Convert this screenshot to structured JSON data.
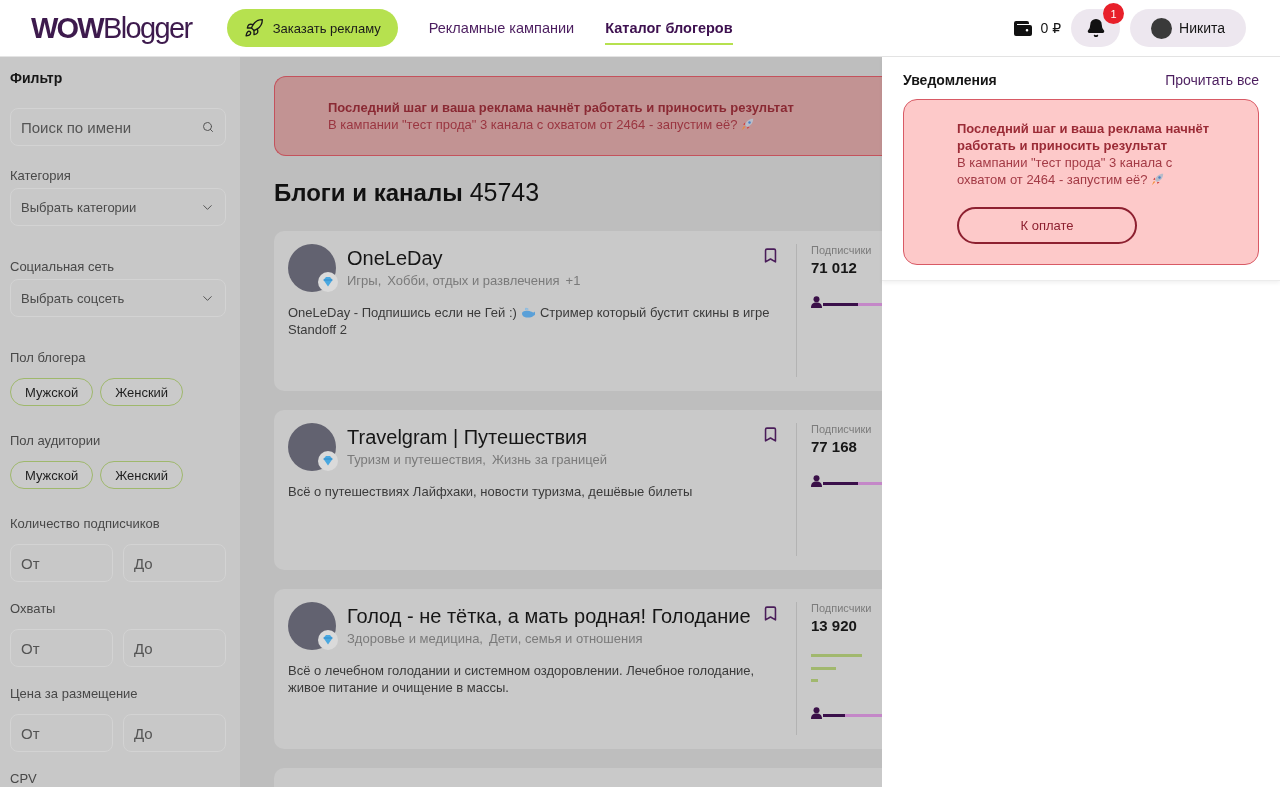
{
  "header": {
    "logo": "**WOW**Blogger",
    "order_button": "Заказать рекламу",
    "nav": [
      {
        "label": "Рекламные кампании",
        "selected": false
      },
      {
        "label": "Каталог блогеров",
        "selected": true
      }
    ],
    "balance": "0 ₽",
    "bell_badge": "1",
    "user": {
      "name": "Никита"
    }
  },
  "filter": {
    "title": "Фильтр",
    "search": {
      "placeholder": "Поиск по имени"
    },
    "groups": [
      {
        "kind": "select",
        "label": "Категория",
        "placeholder": "Выбрать категории"
      },
      {
        "kind": "select",
        "label": "Социальная сеть",
        "placeholder": "Выбрать соцсеть"
      },
      {
        "kind": "chips",
        "label": "Пол блогера",
        "options": [
          {
            "label": "Мужской",
            "selected": false
          },
          {
            "label": "Женский",
            "selected": false
          }
        ]
      },
      {
        "kind": "chips",
        "label": "Пол аудитории",
        "options": [
          {
            "label": "Мужской",
            "selected": false
          },
          {
            "label": "Женский",
            "selected": false
          }
        ]
      },
      {
        "kind": "range",
        "label": "Количество подписчиков",
        "from": {
          "placeholder": "От"
        },
        "to": {
          "placeholder": "До"
        }
      },
      {
        "kind": "range",
        "label": "Охваты",
        "from": {
          "placeholder": "От"
        },
        "to": {
          "placeholder": "До"
        }
      },
      {
        "kind": "range",
        "label": "Цена за размещение",
        "from": {
          "placeholder": "От"
        },
        "to": {
          "placeholder": "До"
        }
      },
      {
        "kind": "label",
        "label": "CPV"
      }
    ]
  },
  "banner": {
    "title": "Последний шаг и ваша реклама начнёт работать и приносить результат",
    "text": "В кампании \"тест прода\" 3 канала с охватом от 2464 - запустим её?"
  },
  "catalog": {
    "title": "Блоги и каналы",
    "count": "45743",
    "blogs": [
      {
        "name": "OneLeDay",
        "categories": [
          "Игры,",
          "Хобби, отдых и развлечения"
        ],
        "more": "+1",
        "description": "OneLeDay - Подпишись если не Гей :)",
        "description_continued": "Стример который бустит скины в игре Standoff 2",
        "bookmarked": false,
        "subscribers_label": "Подписчики",
        "subscribers": "71 012",
        "mini_chart": false,
        "audience": {
          "level": 0.6
        }
      },
      {
        "name": "Travelgram | Путешествия",
        "categories": [
          "Туризм и путешествия,",
          "Жизнь за границей"
        ],
        "description": "Всё о путешествиях Лайфхаки, новости туризма, дешёвые билеты",
        "bookmarked": false,
        "subscribers_label": "Подписчики",
        "subscribers": "77 168",
        "mini_chart": false,
        "audience": {
          "level": 0.6
        }
      },
      {
        "name": "Голод - не тётка, а мать родная! Голодание",
        "categories": [
          "Здоровье и медицина,",
          "Дети, семья и отношения"
        ],
        "description": "Всё о лечебном голодании и системном оздоровлении. Лечебное голодание, живое питание и очищение в массы.",
        "bookmarked": false,
        "subscribers_label": "Подписчики",
        "subscribers": "13 920",
        "mini_chart": true,
        "audience": {
          "level": 0.37
        }
      }
    ]
  },
  "notifications": {
    "title": "Уведомления",
    "read_all": "Прочитать все",
    "items": [
      {
        "title": "Последний шаг и ваша реклама начнёт работать и приносить результат",
        "text": "В кампании \"тест прода\" 3 канала с охватом от 2464 - запустим её?",
        "button": "К оплате"
      }
    ]
  }
}
